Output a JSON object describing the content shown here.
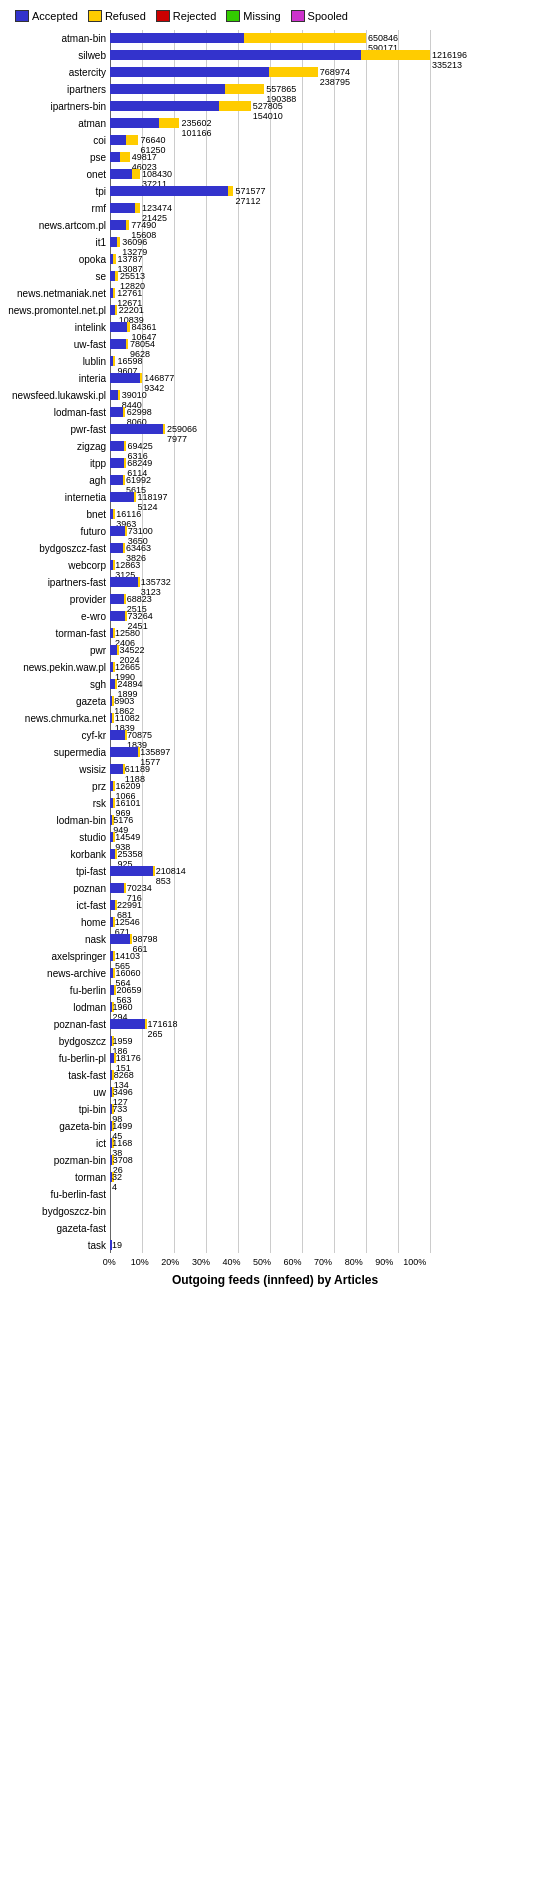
{
  "legend": [
    {
      "label": "Accepted",
      "color": "#3333cc"
    },
    {
      "label": "Refused",
      "color": "#ffcc00"
    },
    {
      "label": "Rejected",
      "color": "#cc0000"
    },
    {
      "label": "Missing",
      "color": "#33cc00"
    },
    {
      "label": "Spooled",
      "color": "#cc33cc"
    }
  ],
  "title": "Outgoing feeds (innfeed) by Articles",
  "xAxisLabels": [
    "0%",
    "10%",
    "20%",
    "30%",
    "40%",
    "50%",
    "60%",
    "70%",
    "80%",
    "90%",
    "100%"
  ],
  "rows": [
    {
      "name": "atman-bin",
      "accepted": 650846,
      "refused": 590171,
      "rejected": 0,
      "missing": 0,
      "spooled": 0,
      "total": 1241017
    },
    {
      "name": "silweb",
      "accepted": 1216196,
      "refused": 335213,
      "rejected": 0,
      "missing": 0,
      "spooled": 0,
      "total": 1551409
    },
    {
      "name": "astercity",
      "accepted": 768974,
      "refused": 238795,
      "rejected": 0,
      "missing": 0,
      "spooled": 0,
      "total": 1007769
    },
    {
      "name": "ipartners",
      "accepted": 557865,
      "refused": 190388,
      "rejected": 0,
      "missing": 0,
      "spooled": 0,
      "total": 748253
    },
    {
      "name": "ipartners-bin",
      "accepted": 527805,
      "refused": 154010,
      "rejected": 0,
      "missing": 0,
      "spooled": 0,
      "total": 681815
    },
    {
      "name": "atman",
      "accepted": 235602,
      "refused": 101166,
      "rejected": 0,
      "missing": 0,
      "spooled": 0,
      "total": 336768
    },
    {
      "name": "coi",
      "accepted": 76640,
      "refused": 61250,
      "rejected": 0,
      "missing": 0,
      "spooled": 0,
      "total": 137890
    },
    {
      "name": "pse",
      "accepted": 49817,
      "refused": 46023,
      "rejected": 0,
      "missing": 0,
      "spooled": 0,
      "total": 95840
    },
    {
      "name": "onet",
      "accepted": 108430,
      "refused": 37211,
      "rejected": 0,
      "missing": 0,
      "spooled": 0,
      "total": 145641
    },
    {
      "name": "tpi",
      "accepted": 571577,
      "refused": 27112,
      "rejected": 0,
      "missing": 0,
      "spooled": 0,
      "total": 598689
    },
    {
      "name": "rmf",
      "accepted": 123474,
      "refused": 21425,
      "rejected": 0,
      "missing": 0,
      "spooled": 0,
      "total": 144899
    },
    {
      "name": "news.artcom.pl",
      "accepted": 77490,
      "refused": 15608,
      "rejected": 0,
      "missing": 0,
      "spooled": 0,
      "total": 93098
    },
    {
      "name": "it1",
      "accepted": 36096,
      "refused": 13279,
      "rejected": 0,
      "missing": 0,
      "spooled": 0,
      "total": 49375
    },
    {
      "name": "opoka",
      "accepted": 13787,
      "refused": 13087,
      "rejected": 0,
      "missing": 0,
      "spooled": 0,
      "total": 26874
    },
    {
      "name": "se",
      "accepted": 25513,
      "refused": 12820,
      "rejected": 0,
      "missing": 0,
      "spooled": 0,
      "total": 38333
    },
    {
      "name": "news.netmaniak.net",
      "accepted": 12761,
      "refused": 12671,
      "rejected": 0,
      "missing": 0,
      "spooled": 0,
      "total": 25432
    },
    {
      "name": "news.promontel.net.pl",
      "accepted": 22201,
      "refused": 10839,
      "rejected": 0,
      "missing": 0,
      "spooled": 0,
      "total": 33040
    },
    {
      "name": "intelink",
      "accepted": 84361,
      "refused": 10647,
      "rejected": 0,
      "missing": 0,
      "spooled": 0,
      "total": 95008
    },
    {
      "name": "uw-fast",
      "accepted": 78054,
      "refused": 9628,
      "rejected": 0,
      "missing": 0,
      "spooled": 0,
      "total": 87682
    },
    {
      "name": "lublin",
      "accepted": 16598,
      "refused": 9607,
      "rejected": 0,
      "missing": 0,
      "spooled": 0,
      "total": 26205
    },
    {
      "name": "interia",
      "accepted": 146877,
      "refused": 9342,
      "rejected": 0,
      "missing": 0,
      "spooled": 0,
      "total": 156219
    },
    {
      "name": "newsfeed.lukawski.pl",
      "accepted": 39010,
      "refused": 8440,
      "rejected": 0,
      "missing": 0,
      "spooled": 0,
      "total": 47450
    },
    {
      "name": "lodman-fast",
      "accepted": 62998,
      "refused": 8060,
      "rejected": 0,
      "missing": 0,
      "spooled": 0,
      "total": 71058
    },
    {
      "name": "pwr-fast",
      "accepted": 259066,
      "refused": 7977,
      "rejected": 0,
      "missing": 0,
      "spooled": 0,
      "total": 267043
    },
    {
      "name": "zigzag",
      "accepted": 69425,
      "refused": 6316,
      "rejected": 0,
      "missing": 0,
      "spooled": 0,
      "total": 75741
    },
    {
      "name": "itpp",
      "accepted": 68249,
      "refused": 6114,
      "rejected": 0,
      "missing": 0,
      "spooled": 0,
      "total": 74363
    },
    {
      "name": "agh",
      "accepted": 61992,
      "refused": 5615,
      "rejected": 0,
      "missing": 0,
      "spooled": 0,
      "total": 67607
    },
    {
      "name": "internetia",
      "accepted": 118197,
      "refused": 5124,
      "rejected": 0,
      "missing": 0,
      "spooled": 0,
      "total": 123321
    },
    {
      "name": "bnet",
      "accepted": 16116,
      "refused": 3963,
      "rejected": 0,
      "missing": 0,
      "spooled": 0,
      "total": 20079
    },
    {
      "name": "futuro",
      "accepted": 73100,
      "refused": 3650,
      "rejected": 0,
      "missing": 0,
      "spooled": 0,
      "total": 76750
    },
    {
      "name": "bydgoszcz-fast",
      "accepted": 63463,
      "refused": 3826,
      "rejected": 0,
      "missing": 0,
      "spooled": 0,
      "total": 67289
    },
    {
      "name": "webcorp",
      "accepted": 12863,
      "refused": 3125,
      "rejected": 0,
      "missing": 0,
      "spooled": 0,
      "total": 15988
    },
    {
      "name": "ipartners-fast",
      "accepted": 135732,
      "refused": 3123,
      "rejected": 0,
      "missing": 0,
      "spooled": 0,
      "total": 138855
    },
    {
      "name": "provider",
      "accepted": 68823,
      "refused": 2515,
      "rejected": 0,
      "missing": 0,
      "spooled": 0,
      "total": 71338
    },
    {
      "name": "e-wro",
      "accepted": 73264,
      "refused": 2451,
      "rejected": 0,
      "missing": 0,
      "spooled": 0,
      "total": 75715
    },
    {
      "name": "torman-fast",
      "accepted": 12580,
      "refused": 2406,
      "rejected": 0,
      "missing": 0,
      "spooled": 0,
      "total": 14986
    },
    {
      "name": "pwr",
      "accepted": 34522,
      "refused": 2024,
      "rejected": 0,
      "missing": 0,
      "spooled": 0,
      "total": 36546
    },
    {
      "name": "news.pekin.waw.pl",
      "accepted": 12665,
      "refused": 1990,
      "rejected": 0,
      "missing": 0,
      "spooled": 0,
      "total": 14655
    },
    {
      "name": "sgh",
      "accepted": 24894,
      "refused": 1899,
      "rejected": 0,
      "missing": 0,
      "spooled": 0,
      "total": 26793
    },
    {
      "name": "gazeta",
      "accepted": 8903,
      "refused": 1862,
      "rejected": 0,
      "missing": 0,
      "spooled": 0,
      "total": 10765
    },
    {
      "name": "news.chmurka.net",
      "accepted": 11082,
      "refused": 1839,
      "rejected": 0,
      "missing": 0,
      "spooled": 0,
      "total": 12921
    },
    {
      "name": "cyf-kr",
      "accepted": 70875,
      "refused": 1839,
      "rejected": 0,
      "missing": 0,
      "spooled": 0,
      "total": 72714
    },
    {
      "name": "supermedia",
      "accepted": 135897,
      "refused": 1577,
      "rejected": 0,
      "missing": 0,
      "spooled": 0,
      "total": 137474
    },
    {
      "name": "wsisiz",
      "accepted": 61189,
      "refused": 1188,
      "rejected": 0,
      "missing": 0,
      "spooled": 0,
      "total": 62377
    },
    {
      "name": "prz",
      "accepted": 16209,
      "refused": 1066,
      "rejected": 0,
      "missing": 0,
      "spooled": 0,
      "total": 17275
    },
    {
      "name": "rsk",
      "accepted": 16101,
      "refused": 969,
      "rejected": 0,
      "missing": 0,
      "spooled": 0,
      "total": 17070
    },
    {
      "name": "lodman-bin",
      "accepted": 5176,
      "refused": 949,
      "rejected": 0,
      "missing": 0,
      "spooled": 0,
      "total": 6125
    },
    {
      "name": "studio",
      "accepted": 14549,
      "refused": 938,
      "rejected": 0,
      "missing": 0,
      "spooled": 0,
      "total": 15487
    },
    {
      "name": "korbank",
      "accepted": 25358,
      "refused": 925,
      "rejected": 0,
      "missing": 0,
      "spooled": 0,
      "total": 26283
    },
    {
      "name": "tpi-fast",
      "accepted": 210814,
      "refused": 853,
      "rejected": 0,
      "missing": 0,
      "spooled": 0,
      "total": 211667
    },
    {
      "name": "poznan",
      "accepted": 70234,
      "refused": 716,
      "rejected": 0,
      "missing": 0,
      "spooled": 0,
      "total": 70950
    },
    {
      "name": "ict-fast",
      "accepted": 22991,
      "refused": 681,
      "rejected": 0,
      "missing": 0,
      "spooled": 0,
      "total": 23672
    },
    {
      "name": "home",
      "accepted": 12546,
      "refused": 671,
      "rejected": 0,
      "missing": 0,
      "spooled": 0,
      "total": 13217
    },
    {
      "name": "nask",
      "accepted": 98798,
      "refused": 661,
      "rejected": 0,
      "missing": 0,
      "spooled": 0,
      "total": 99459
    },
    {
      "name": "axelspringer",
      "accepted": 14103,
      "refused": 565,
      "rejected": 0,
      "missing": 0,
      "spooled": 0,
      "total": 14668
    },
    {
      "name": "news-archive",
      "accepted": 16060,
      "refused": 564,
      "rejected": 0,
      "missing": 0,
      "spooled": 0,
      "total": 16624
    },
    {
      "name": "fu-berlin",
      "accepted": 20659,
      "refused": 563,
      "rejected": 0,
      "missing": 0,
      "spooled": 0,
      "total": 21222
    },
    {
      "name": "lodman",
      "accepted": 1960,
      "refused": 294,
      "rejected": 0,
      "missing": 0,
      "spooled": 0,
      "total": 2254
    },
    {
      "name": "poznan-fast",
      "accepted": 171618,
      "refused": 265,
      "rejected": 0,
      "missing": 0,
      "spooled": 0,
      "total": 171883
    },
    {
      "name": "bydgoszcz",
      "accepted": 1959,
      "refused": 186,
      "rejected": 0,
      "missing": 0,
      "spooled": 0,
      "total": 2145
    },
    {
      "name": "fu-berlin-pl",
      "accepted": 18176,
      "refused": 151,
      "rejected": 0,
      "missing": 0,
      "spooled": 0,
      "total": 18327
    },
    {
      "name": "task-fast",
      "accepted": 8268,
      "refused": 134,
      "rejected": 0,
      "missing": 0,
      "spooled": 0,
      "total": 8402
    },
    {
      "name": "uw",
      "accepted": 3496,
      "refused": 127,
      "rejected": 0,
      "missing": 0,
      "spooled": 0,
      "total": 3623
    },
    {
      "name": "tpi-bin",
      "accepted": 733,
      "refused": 98,
      "rejected": 0,
      "missing": 0,
      "spooled": 0,
      "total": 831
    },
    {
      "name": "gazeta-bin",
      "accepted": 1499,
      "refused": 45,
      "rejected": 0,
      "missing": 0,
      "spooled": 0,
      "total": 1544
    },
    {
      "name": "ict",
      "accepted": 1168,
      "refused": 38,
      "rejected": 0,
      "missing": 0,
      "spooled": 0,
      "total": 1206
    },
    {
      "name": "pozman-bin",
      "accepted": 3708,
      "refused": 26,
      "rejected": 0,
      "missing": 0,
      "spooled": 0,
      "total": 3734
    },
    {
      "name": "torman",
      "accepted": 32,
      "refused": 4,
      "rejected": 0,
      "missing": 0,
      "spooled": 0,
      "total": 36
    },
    {
      "name": "fu-berlin-fast",
      "accepted": 0,
      "refused": 0,
      "rejected": 0,
      "missing": 0,
      "spooled": 0,
      "total": 0
    },
    {
      "name": "bydgoszcz-bin",
      "accepted": 0,
      "refused": 0,
      "rejected": 0,
      "missing": 0,
      "spooled": 0,
      "total": 0
    },
    {
      "name": "gazeta-fast",
      "accepted": 0,
      "refused": 0,
      "rejected": 0,
      "missing": 0,
      "spooled": 0,
      "total": 0
    },
    {
      "name": "task",
      "accepted": 19,
      "refused": 0,
      "rejected": 0,
      "missing": 0,
      "spooled": 0,
      "total": 19
    }
  ]
}
